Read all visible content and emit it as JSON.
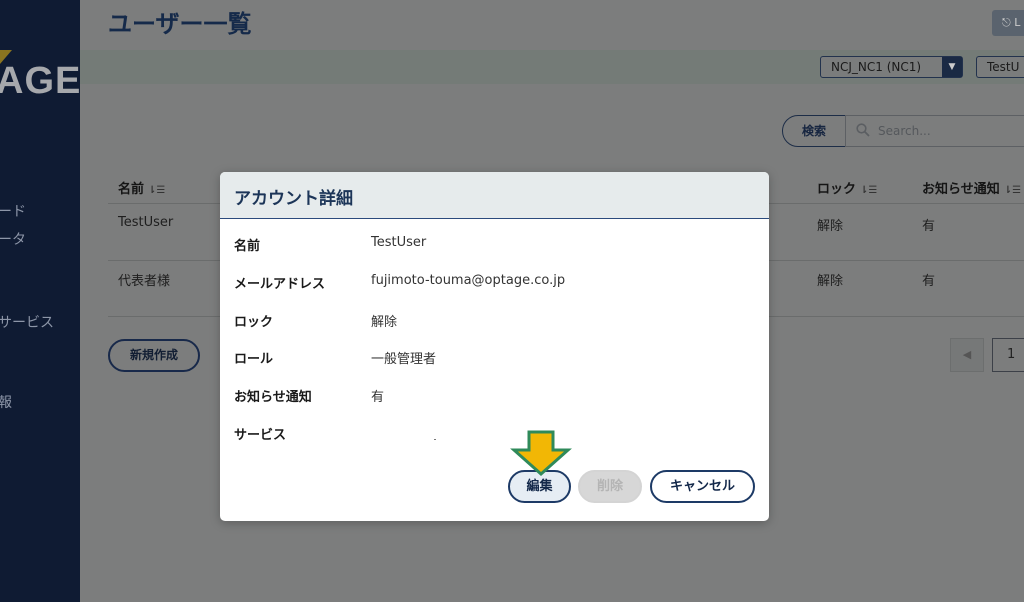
{
  "sidebar": {
    "logo_text": "AGE",
    "items": [
      {
        "label": "ード"
      },
      {
        "label": "ータ"
      },
      {
        "label": "サービス"
      },
      {
        "label": "報"
      }
    ]
  },
  "header": {
    "title": "ユーザー一覧",
    "logout_label": "⎋ L"
  },
  "filters": {
    "contract_select": "NCJ_NC1 (NC1)",
    "user_select": "TestU"
  },
  "search": {
    "button_label": "検索",
    "placeholder": "Search..."
  },
  "table": {
    "headers": {
      "name": "名前",
      "lock": "ロック",
      "notify": "お知らせ通知"
    },
    "rows": [
      {
        "name": "TestUser",
        "lock": "解除",
        "notify": "有"
      },
      {
        "name": "代表者様",
        "lock": "解除",
        "notify": "有"
      }
    ]
  },
  "actions": {
    "new_label": "新規作成"
  },
  "pagination": {
    "prev_label": "◀",
    "current_page": "1"
  },
  "modal": {
    "title": "アカウント詳細",
    "fields": [
      {
        "label": "名前",
        "value": "TestUser"
      },
      {
        "label": "メールアドレス",
        "value": "fujimoto-touma@optage.co.jp"
      },
      {
        "label": "ロック",
        "value": "解除"
      },
      {
        "label": "ロール",
        "value": "一般管理者"
      },
      {
        "label": "お知らせ通知",
        "value": "有"
      },
      {
        "label": "サービス",
        "value": ""
      }
    ],
    "buttons": {
      "edit": "編集",
      "delete": "削除",
      "cancel": "キャンセル"
    }
  },
  "colors": {
    "sidebar_bg": "#0f1b33",
    "overlay_bg": "#7c7d7d",
    "accent_navy": "#1d3a66",
    "highlight_arrow": "#f2b705",
    "arrow_outline": "#2f8a5a"
  },
  "icons": {
    "search": "search-icon",
    "sort": "sort-icon",
    "dropdown": "chevron-down-icon",
    "pointer": "down-arrow-icon"
  }
}
